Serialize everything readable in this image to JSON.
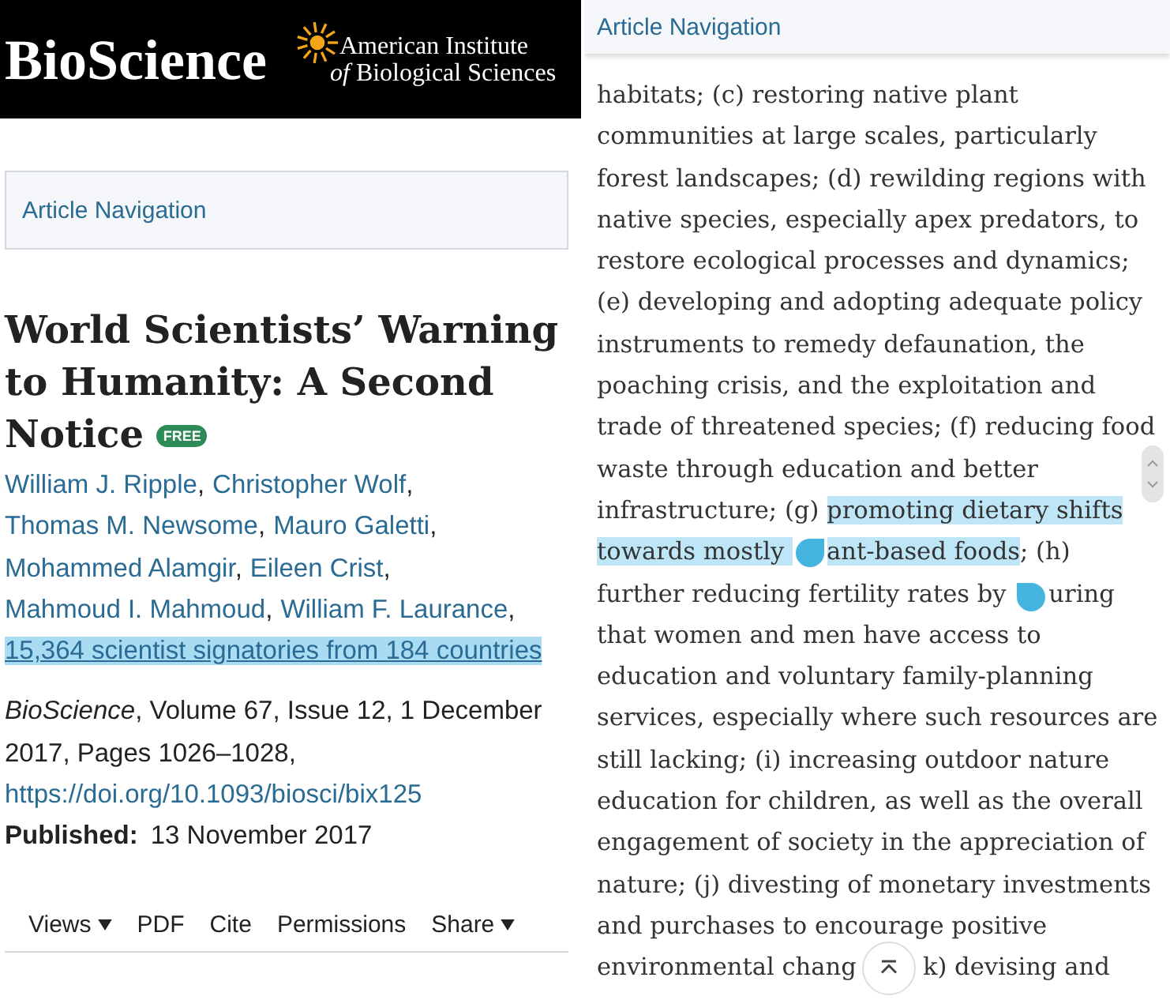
{
  "left": {
    "header": {
      "journal": "BioScience",
      "publisher_line_1": "American Institute",
      "publisher_prefix": "of",
      "publisher_line_2": "Biological Sciences"
    },
    "article_navigation": "Article Navigation",
    "title": "World Scientists’ Warning to Humanity: A Second Notice",
    "badge": "FREE",
    "authors": [
      {
        "name": "William J. Ripple",
        "sep": ","
      },
      {
        "name": "Christopher Wolf",
        "sep": ","
      },
      {
        "name": "Thomas M. Newsome",
        "sep": ","
      },
      {
        "name": "Mauro Galetti",
        "sep": ","
      },
      {
        "name": "Mohammed Alamgir",
        "sep": ","
      },
      {
        "name": "Eileen Crist",
        "sep": ","
      },
      {
        "name": "Mahmoud I. Mahmoud",
        "sep": ","
      },
      {
        "name": "William F. Laurance",
        "sep": ","
      }
    ],
    "signatories": {
      "text": "15,364 scientist signatories from 184 countries",
      "selected": true
    },
    "citation": "*BioScience*, Volume 67, Issue 12, 1 December 2017, Pages 1026–1028,",
    "doi": "https://doi.org/10.1093/biosci/bix125",
    "published_label": "Published:",
    "published_date": "13 November 2017",
    "toolbar": [
      {
        "label": "Views",
        "dropdown": true
      },
      {
        "label": "PDF",
        "dropdown": false
      },
      {
        "label": "Cite",
        "dropdown": false
      },
      {
        "label": "Permissions",
        "dropdown": false
      },
      {
        "label": "Share",
        "dropdown": true
      }
    ]
  },
  "right": {
    "article_navigation": "Article Navigation",
    "paragraph": [
      [
        {
          "text": "habitats; (c) restoring native plant",
          "selected": false
        }
      ],
      [
        {
          "text": "communities at large scales, particularly",
          "selected": false
        }
      ],
      [
        {
          "text": "forest landscapes; (d) rewilding regions with",
          "selected": false
        }
      ],
      [
        {
          "text": "native species, especially apex predators, to",
          "selected": false
        }
      ],
      [
        {
          "text": "restore ecological processes and dynamics;",
          "selected": false
        }
      ],
      [
        {
          "text": "(e) developing and adopting adequate policy",
          "selected": false
        }
      ],
      [
        {
          "text": "instruments to remedy defaunation, the",
          "selected": false
        }
      ],
      [
        {
          "text": "poaching crisis, and the exploitation and",
          "selected": false
        }
      ],
      [
        {
          "text": "trade of threatened species; (f) reducing food",
          "selected": false
        }
      ],
      [
        {
          "text": "waste through education and better",
          "selected": false
        }
      ],
      [
        {
          "text": "infrastructure; (g) ",
          "selected": false
        },
        {
          "text": "promoting dietary shifts",
          "selected": true
        }
      ],
      [
        {
          "text": "towards mostly ",
          "selected": true
        },
        {
          "kind": "start_handle"
        },
        {
          "text": "ant-based foods",
          "selected": true
        },
        {
          "text": "; (h)",
          "selected": false
        }
      ],
      [
        {
          "text": "further reducing fertility rates by ",
          "selected": false
        },
        {
          "kind": "end_handle"
        },
        {
          "text": "uring",
          "selected": false
        }
      ],
      [
        {
          "text": "that women and men have access to",
          "selected": false
        }
      ],
      [
        {
          "text": "education and voluntary family-planning",
          "selected": false
        }
      ],
      [
        {
          "text": "services, especially where such resources are",
          "selected": false
        }
      ],
      [
        {
          "text": "still lacking; (i) increasing outdoor nature",
          "selected": false
        }
      ],
      [
        {
          "text": "education for children, as well as the overall",
          "selected": false
        }
      ],
      [
        {
          "text": "engagement of society in the appreciation of",
          "selected": false
        }
      ],
      [
        {
          "text": "nature; (j) divesting of monetary investments",
          "selected": false
        }
      ],
      [
        {
          "text": "and purchases to encourage positive",
          "selected": false
        }
      ],
      [
        {
          "text": "environmental chang",
          "selected": false
        },
        {
          "kind": "scroll_top_button"
        },
        {
          "text": "k) devising and",
          "selected": false
        }
      ]
    ]
  }
}
